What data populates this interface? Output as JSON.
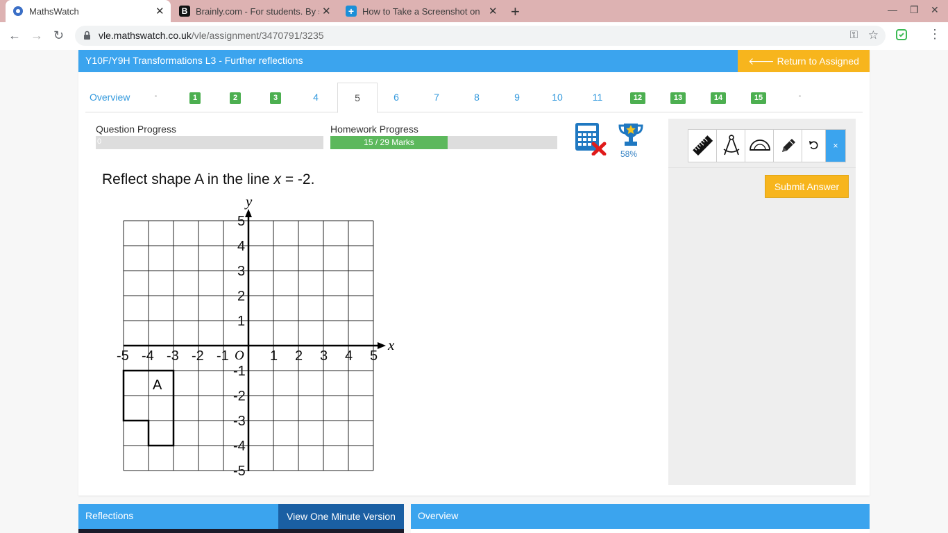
{
  "browser": {
    "tabs": [
      {
        "title": "MathsWatch",
        "active": true
      },
      {
        "title": "Brainly.com - For students. By st",
        "active": false
      },
      {
        "title": "How to Take a Screenshot on a C",
        "active": false
      }
    ],
    "url_domain": "vle.mathswatch.co.uk",
    "url_path": "/vle/assignment/3470791/3235"
  },
  "header": {
    "title": "Y10F/Y9H Transformations L3 - Further reflections",
    "return_label": "Return to Assigned Work"
  },
  "question_nav": {
    "overview_label": "Overview",
    "items": [
      {
        "label": "1",
        "answered": true
      },
      {
        "label": "2",
        "answered": true
      },
      {
        "label": "3",
        "answered": true
      },
      {
        "label": "4",
        "answered": false
      },
      {
        "label": "5",
        "answered": false,
        "current": true
      },
      {
        "label": "6",
        "answered": false
      },
      {
        "label": "7",
        "answered": false
      },
      {
        "label": "8",
        "answered": false
      },
      {
        "label": "9",
        "answered": false
      },
      {
        "label": "10",
        "answered": false
      },
      {
        "label": "11",
        "answered": false
      },
      {
        "label": "12",
        "answered": true
      },
      {
        "label": "13",
        "answered": true
      },
      {
        "label": "14",
        "answered": true
      },
      {
        "label": "15",
        "answered": true
      }
    ]
  },
  "progress": {
    "question_label": "Question Progress",
    "question_value": "0",
    "question_fraction": 0,
    "homework_label": "Homework Progress",
    "homework_text": "15 / 29 Marks",
    "homework_fraction": 0.517,
    "trophy_percent": "58%"
  },
  "question": {
    "text_before": "Reflect shape A in the line ",
    "var": "x",
    "text_after": " = -2.",
    "axis_x_label": "x",
    "axis_y_label": "y",
    "origin_label": "O",
    "shape_label": "A",
    "x_ticks": [
      "-5",
      "-4",
      "-3",
      "-2",
      "-1",
      "1",
      "2",
      "3",
      "4",
      "5"
    ],
    "y_ticks": [
      "5",
      "4",
      "3",
      "2",
      "1",
      "-1",
      "-2",
      "-3",
      "-4",
      "-5"
    ]
  },
  "panel": {
    "submit_label": "Submit Answer",
    "close_label": "×",
    "tools": [
      "ruler-icon",
      "compass-icon",
      "protractor-icon",
      "pencil-icon",
      "undo-icon"
    ]
  },
  "bottom": {
    "left_title": "Reflections",
    "left_button": "View One Minute Version",
    "right_title": "Overview"
  },
  "colors": {
    "header_blue": "#3ba4ee",
    "accent_yellow": "#f7b51d",
    "badge_green": "#4caf50"
  }
}
